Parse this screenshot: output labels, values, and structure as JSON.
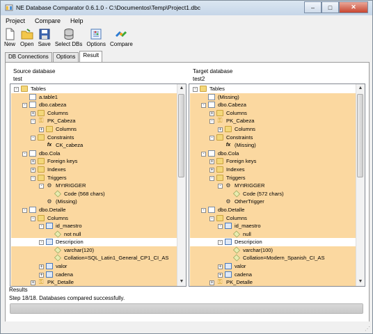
{
  "window": {
    "title": "NE Database Comparator 0.6.1.0 - C:\\Documentos\\Temp\\Project1.dbc",
    "minimize": "–",
    "maximize": "□",
    "close": "✕"
  },
  "menu": [
    {
      "label": "Project"
    },
    {
      "label": "Compare"
    },
    {
      "label": "Help"
    }
  ],
  "toolbar": [
    {
      "label": "New",
      "icon": "new-file-icon"
    },
    {
      "label": "Open",
      "icon": "open-folder-icon"
    },
    {
      "label": "Save",
      "icon": "save-disk-icon"
    },
    {
      "label": "Select DBs",
      "icon": "database-icon"
    },
    {
      "label": "Options",
      "icon": "options-icon"
    },
    {
      "label": "Compare",
      "icon": "compare-icon"
    }
  ],
  "tabs": [
    {
      "label": "DB Connections",
      "active": false
    },
    {
      "label": "Options",
      "active": false
    },
    {
      "label": "Result",
      "active": true
    }
  ],
  "source": {
    "heading": "Source database",
    "db": "test",
    "rows": [
      {
        "level": 0,
        "exp": "-",
        "icon": "folder",
        "label": "Tables",
        "hl": false
      },
      {
        "level": 1,
        "exp": "",
        "icon": "table",
        "label": "a.table1",
        "hl": true
      },
      {
        "level": 1,
        "exp": "-",
        "icon": "table",
        "label": "dbo.cabeza",
        "hl": true
      },
      {
        "level": 2,
        "exp": "+",
        "icon": "folder",
        "label": "Columns",
        "hl": true
      },
      {
        "level": 2,
        "exp": "-",
        "icon": "key",
        "label": "PK_Cabeza",
        "hl": true
      },
      {
        "level": 3,
        "exp": "+",
        "icon": "folder",
        "label": "Columns",
        "hl": true
      },
      {
        "level": 2,
        "exp": "-",
        "icon": "folder",
        "label": "Constraints",
        "hl": true
      },
      {
        "level": 3,
        "exp": "",
        "icon": "fx",
        "label": "CK_cabeza",
        "hl": true
      },
      {
        "level": 1,
        "exp": "-",
        "icon": "table",
        "label": "dbo.Cola",
        "hl": true
      },
      {
        "level": 2,
        "exp": "+",
        "icon": "folder",
        "label": "Foreign keys",
        "hl": true
      },
      {
        "level": 2,
        "exp": "+",
        "icon": "folder",
        "label": "Indexes",
        "hl": true
      },
      {
        "level": 2,
        "exp": "-",
        "icon": "folder",
        "label": "Triggers",
        "hl": true
      },
      {
        "level": 3,
        "exp": "-",
        "icon": "trigger",
        "label": "MYtRIGGER",
        "hl": true
      },
      {
        "level": 4,
        "exp": "",
        "icon": "leaf",
        "label": "Code (568 chars)",
        "hl": true
      },
      {
        "level": 3,
        "exp": "",
        "icon": "trigger",
        "label": "(Missing)",
        "hl": true
      },
      {
        "level": 1,
        "exp": "-",
        "icon": "table",
        "label": "dbo.Detalle",
        "hl": true
      },
      {
        "level": 2,
        "exp": "-",
        "icon": "folder",
        "label": "Columns",
        "hl": true
      },
      {
        "level": 3,
        "exp": "-",
        "icon": "column",
        "label": "id_maestro",
        "hl": true
      },
      {
        "level": 4,
        "exp": "",
        "icon": "leaf",
        "label": "not null",
        "hl": true
      },
      {
        "level": 3,
        "exp": "-",
        "icon": "column",
        "label": "Descripcion",
        "hl": false
      },
      {
        "level": 4,
        "exp": "",
        "icon": "leaf",
        "label": "varchar(120)",
        "hl": true
      },
      {
        "level": 4,
        "exp": "",
        "icon": "leaf",
        "label": "Collation=SQL_Latin1_General_CP1_CI_AS",
        "hl": true
      },
      {
        "level": 3,
        "exp": "+",
        "icon": "column",
        "label": "valor",
        "hl": true
      },
      {
        "level": 3,
        "exp": "+",
        "icon": "column",
        "label": "cadena",
        "hl": true
      },
      {
        "level": 2,
        "exp": "+",
        "icon": "key",
        "label": "PK_Detalle",
        "hl": true
      }
    ]
  },
  "target": {
    "heading": "Target database",
    "db": "test2",
    "rows": [
      {
        "level": 0,
        "exp": "-",
        "icon": "folder",
        "label": "Tables",
        "hl": false
      },
      {
        "level": 1,
        "exp": "",
        "icon": "table",
        "label": "(Missing)",
        "hl": true
      },
      {
        "level": 1,
        "exp": "-",
        "icon": "table",
        "label": "dbo.Cabeza",
        "hl": true
      },
      {
        "level": 2,
        "exp": "+",
        "icon": "folder",
        "label": "Columns",
        "hl": true
      },
      {
        "level": 2,
        "exp": "-",
        "icon": "key",
        "label": "PK_Cabeza",
        "hl": true
      },
      {
        "level": 3,
        "exp": "+",
        "icon": "folder",
        "label": "Columns",
        "hl": true
      },
      {
        "level": 2,
        "exp": "-",
        "icon": "folder",
        "label": "Constraints",
        "hl": true
      },
      {
        "level": 3,
        "exp": "",
        "icon": "fx",
        "label": "(Missing)",
        "hl": true
      },
      {
        "level": 1,
        "exp": "-",
        "icon": "table",
        "label": "dbo.Cola",
        "hl": true
      },
      {
        "level": 2,
        "exp": "+",
        "icon": "folder",
        "label": "Foreign keys",
        "hl": true
      },
      {
        "level": 2,
        "exp": "+",
        "icon": "folder",
        "label": "Indexes",
        "hl": true
      },
      {
        "level": 2,
        "exp": "-",
        "icon": "folder",
        "label": "Triggers",
        "hl": true
      },
      {
        "level": 3,
        "exp": "-",
        "icon": "trigger",
        "label": "MYtRIGGER",
        "hl": true
      },
      {
        "level": 4,
        "exp": "",
        "icon": "leaf",
        "label": "Code (572 chars)",
        "hl": true
      },
      {
        "level": 3,
        "exp": "",
        "icon": "trigger",
        "label": "OtherTrigger",
        "hl": true
      },
      {
        "level": 1,
        "exp": "-",
        "icon": "table",
        "label": "dbo.Detalle",
        "hl": true
      },
      {
        "level": 2,
        "exp": "-",
        "icon": "folder",
        "label": "Columns",
        "hl": true
      },
      {
        "level": 3,
        "exp": "-",
        "icon": "column",
        "label": "id_maestro",
        "hl": true
      },
      {
        "level": 4,
        "exp": "",
        "icon": "leaf",
        "label": "null",
        "hl": true
      },
      {
        "level": 3,
        "exp": "-",
        "icon": "column",
        "label": "Descripcion",
        "hl": false
      },
      {
        "level": 4,
        "exp": "",
        "icon": "leaf",
        "label": "varchar(100)",
        "hl": true
      },
      {
        "level": 4,
        "exp": "",
        "icon": "leaf",
        "label": "Collation=Modern_Spanish_CI_AS",
        "hl": true
      },
      {
        "level": 3,
        "exp": "+",
        "icon": "column",
        "label": "valor",
        "hl": true
      },
      {
        "level": 3,
        "exp": "+",
        "icon": "column",
        "label": "cadena",
        "hl": true
      },
      {
        "level": 2,
        "exp": "+",
        "icon": "key",
        "label": "PK_Detalle",
        "hl": true
      }
    ]
  },
  "results": {
    "heading": "Results",
    "message": "Step 18/18. Databases compared successfully.",
    "progress": 1.0
  },
  "colors": {
    "highlight": "#fbd8a0"
  }
}
